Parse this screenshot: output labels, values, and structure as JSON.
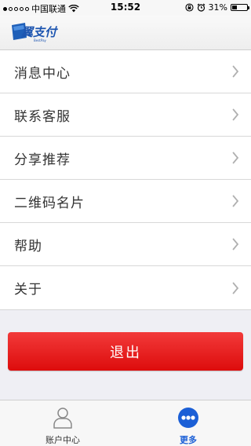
{
  "status_bar": {
    "carrier": "中国联通",
    "time": "15:52",
    "battery_percent": "31%",
    "battery_level": 0.31
  },
  "header": {
    "logo_text": "翼支付"
  },
  "menu": {
    "items": [
      {
        "label": "消息中心"
      },
      {
        "label": "联系客服"
      },
      {
        "label": "分享推荐"
      },
      {
        "label": "二维码名片"
      },
      {
        "label": "帮助"
      },
      {
        "label": "关于"
      }
    ]
  },
  "logout_label": "退出",
  "tabbar": {
    "tabs": [
      {
        "label": "账户中心",
        "icon": "person-icon"
      },
      {
        "label": "更多",
        "icon": "more-icon",
        "active": true
      }
    ]
  },
  "colors": {
    "accent": "#1b5fd6",
    "logout_red": "#e81b1b",
    "background": "#efeff4"
  }
}
